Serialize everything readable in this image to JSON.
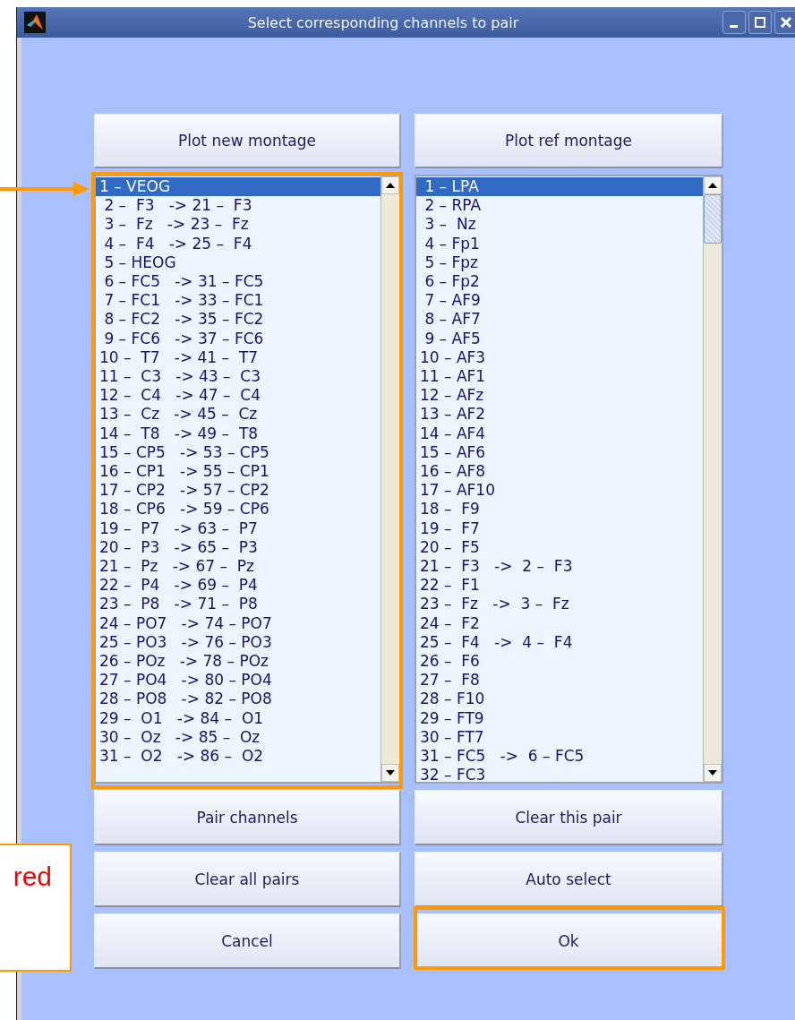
{
  "window": {
    "title": "Select corresponding channels to pair"
  },
  "top_buttons": [
    "Plot new montage",
    "Plot ref montage"
  ],
  "lists": [
    {
      "scroll_thumb": false,
      "rows": [
        {
          "text": "1 – VEOG",
          "selected": true
        },
        {
          "text": " 2 –  F3   -> 21 –  F3",
          "selected": false
        },
        {
          "text": " 3 –  Fz   -> 23 –  Fz",
          "selected": false
        },
        {
          "text": " 4 –  F4   -> 25 –  F4",
          "selected": false
        },
        {
          "text": " 5 – HEOG",
          "selected": false
        },
        {
          "text": " 6 – FC5   -> 31 – FC5",
          "selected": false
        },
        {
          "text": " 7 – FC1   -> 33 – FC1",
          "selected": false
        },
        {
          "text": " 8 – FC2   -> 35 – FC2",
          "selected": false
        },
        {
          "text": " 9 – FC6   -> 37 – FC6",
          "selected": false
        },
        {
          "text": "10 –  T7   -> 41 –  T7",
          "selected": false
        },
        {
          "text": "11 –  C3   -> 43 –  C3",
          "selected": false
        },
        {
          "text": "12 –  C4   -> 47 –  C4",
          "selected": false
        },
        {
          "text": "13 –  Cz   -> 45 –  Cz",
          "selected": false
        },
        {
          "text": "14 –  T8   -> 49 –  T8",
          "selected": false
        },
        {
          "text": "15 – CP5   -> 53 – CP5",
          "selected": false
        },
        {
          "text": "16 – CP1   -> 55 – CP1",
          "selected": false
        },
        {
          "text": "17 – CP2   -> 57 – CP2",
          "selected": false
        },
        {
          "text": "18 – CP6   -> 59 – CP6",
          "selected": false
        },
        {
          "text": "19 –  P7   -> 63 –  P7",
          "selected": false
        },
        {
          "text": "20 –  P3   -> 65 –  P3",
          "selected": false
        },
        {
          "text": "21 –  Pz   -> 67 –  Pz",
          "selected": false
        },
        {
          "text": "22 –  P4   -> 69 –  P4",
          "selected": false
        },
        {
          "text": "23 –  P8   -> 71 –  P8",
          "selected": false
        },
        {
          "text": "24 – PO7   -> 74 – PO7",
          "selected": false
        },
        {
          "text": "25 – PO3   -> 76 – PO3",
          "selected": false
        },
        {
          "text": "26 – POz   -> 78 – POz",
          "selected": false
        },
        {
          "text": "27 – PO4   -> 80 – PO4",
          "selected": false
        },
        {
          "text": "28 – PO8   -> 82 – PO8",
          "selected": false
        },
        {
          "text": "29 –  O1   -> 84 –  O1",
          "selected": false
        },
        {
          "text": "30 –  Oz   -> 85 –  Oz",
          "selected": false
        },
        {
          "text": "31 –  O2   -> 86 –  O2",
          "selected": false
        }
      ]
    },
    {
      "scroll_thumb": true,
      "rows": [
        {
          "text": " 1 – LPA",
          "selected": true
        },
        {
          "text": " 2 – RPA",
          "selected": false
        },
        {
          "text": " 3 –  Nz",
          "selected": false
        },
        {
          "text": " 4 – Fp1",
          "selected": false
        },
        {
          "text": " 5 – Fpz",
          "selected": false
        },
        {
          "text": " 6 – Fp2",
          "selected": false
        },
        {
          "text": " 7 – AF9",
          "selected": false
        },
        {
          "text": " 8 – AF7",
          "selected": false
        },
        {
          "text": " 9 – AF5",
          "selected": false
        },
        {
          "text": "10 – AF3",
          "selected": false
        },
        {
          "text": "11 – AF1",
          "selected": false
        },
        {
          "text": "12 – AFz",
          "selected": false
        },
        {
          "text": "13 – AF2",
          "selected": false
        },
        {
          "text": "14 – AF4",
          "selected": false
        },
        {
          "text": "15 – AF6",
          "selected": false
        },
        {
          "text": "16 – AF8",
          "selected": false
        },
        {
          "text": "17 – AF10",
          "selected": false
        },
        {
          "text": "18 –  F9",
          "selected": false
        },
        {
          "text": "19 –  F7",
          "selected": false
        },
        {
          "text": "20 –  F5",
          "selected": false
        },
        {
          "text": "21 –  F3   ->  2 –  F3",
          "selected": false
        },
        {
          "text": "22 –  F1",
          "selected": false
        },
        {
          "text": "23 –  Fz   ->  3 –  Fz",
          "selected": false
        },
        {
          "text": "24 –  F2",
          "selected": false
        },
        {
          "text": "25 –  F4   ->  4 –  F4",
          "selected": false
        },
        {
          "text": "26 –  F6",
          "selected": false
        },
        {
          "text": "27 –  F8",
          "selected": false
        },
        {
          "text": "28 – F10",
          "selected": false
        },
        {
          "text": "29 – FT9",
          "selected": false
        },
        {
          "text": "30 – FT7",
          "selected": false
        },
        {
          "text": "31 – FC5   ->  6 – FC5",
          "selected": false
        },
        {
          "text": "32 – FC3",
          "selected": false
        }
      ]
    }
  ],
  "bottom_buttons": [
    "Pair channels",
    "Clear this pair",
    "Clear all pairs",
    "Auto select",
    "Cancel",
    "Ok"
  ],
  "annotation": {
    "callout_text": "red"
  }
}
